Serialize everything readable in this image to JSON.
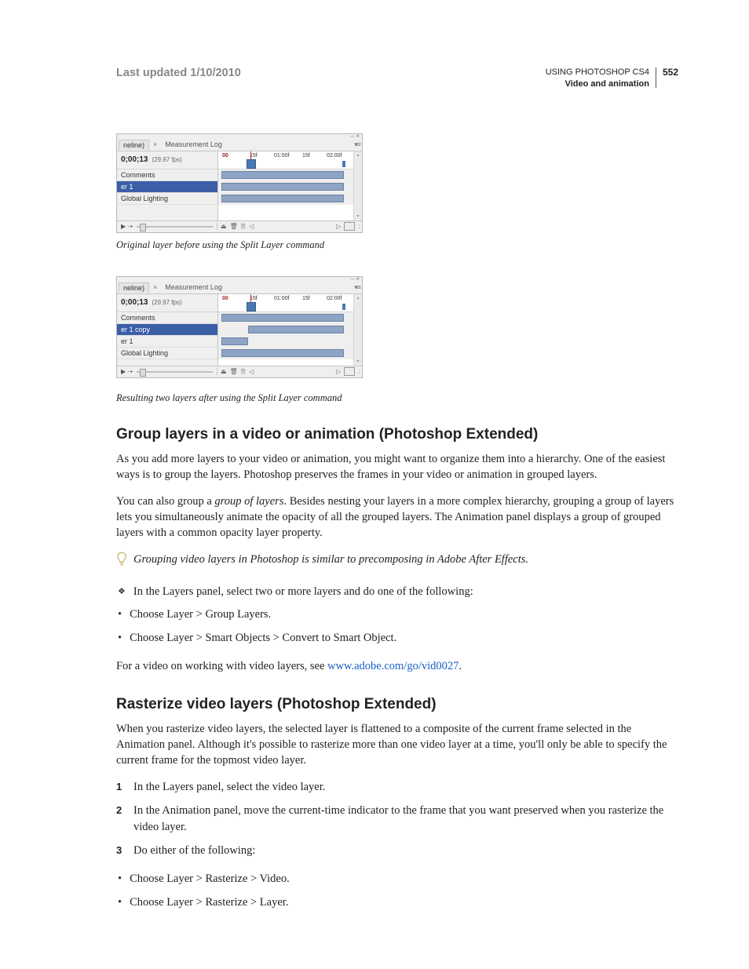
{
  "header": {
    "last_updated": "Last updated 1/10/2010",
    "doc_title": "USING PHOTOSHOP CS4",
    "section": "Video and animation",
    "page_no": "552"
  },
  "figure1": {
    "tab_active": "neline)",
    "tab2": "Measurement Log",
    "win_icons": "–  ×",
    "menu_icon": "▾≡",
    "timecode": "0;00;13",
    "fps": "(29.97 fps)",
    "ruler": {
      "t0": "00",
      "t1": "15f",
      "t2": "01:00f",
      "t3": "15f",
      "t4": "02:00f"
    },
    "tracks": {
      "comments": "Comments",
      "er1": "er 1",
      "global": "Global Lighting"
    },
    "caption": "Original layer before using the Split Layer command"
  },
  "figure2": {
    "tab_active": "neline)",
    "tab2": "Measurement Log",
    "win_icons": "–  ×",
    "menu_icon": "▾≡",
    "timecode": "0;00;13",
    "fps": "(29.97 fps)",
    "ruler": {
      "t0": "00",
      "t1": "15f",
      "t2": "01:00f",
      "t3": "15f",
      "t4": "02:00f"
    },
    "tracks": {
      "comments": "Comments",
      "er1copy": "er 1 copy",
      "er1": "er 1",
      "global": "Global Lighting"
    },
    "caption": "Resulting two layers after using the Split Layer command"
  },
  "section1": {
    "title": "Group layers in a video or animation (Photoshop Extended)",
    "p1": "As you add more layers to your video or animation, you might want to organize them into a hierarchy. One of the easiest ways is to group the layers. Photoshop preserves the frames in your video or animation in grouped layers.",
    "p2a": "You can also group a ",
    "p2b": "group of layers",
    "p2c": ". Besides nesting your layers in a more complex hierarchy, grouping a group of layers lets you simultaneously animate the opacity of all the grouped layers. The Animation panel displays a group of grouped layers with a common opacity layer property.",
    "tip": "Grouping video layers in Photoshop is similar to precomposing in Adobe After Effects.",
    "diamond": "In the Layers panel, select two or more layers and do one of the following:",
    "b1": "Choose Layer > Group Layers.",
    "b2": "Choose Layer > Smart Objects > Convert to Smart Object.",
    "p3a": "For a video on working with video layers, see ",
    "link": "www.adobe.com/go/vid0027",
    "p3b": "."
  },
  "section2": {
    "title": "Rasterize video layers (Photoshop Extended)",
    "p1": "When you rasterize video layers, the selected layer is flattened to a composite of the current frame selected in the Animation panel. Although it's possible to rasterize more than one video layer at a time, you'll only be able to specify the current frame for the topmost video layer.",
    "step1": "In the Layers panel, select the video layer.",
    "step2": "In the Animation panel, move the current-time indicator to the frame that you want preserved when you rasterize the video layer.",
    "step3": "Do either of the following:",
    "b1": "Choose Layer > Rasterize > Video.",
    "b2": "Choose Layer > Rasterize > Layer."
  }
}
